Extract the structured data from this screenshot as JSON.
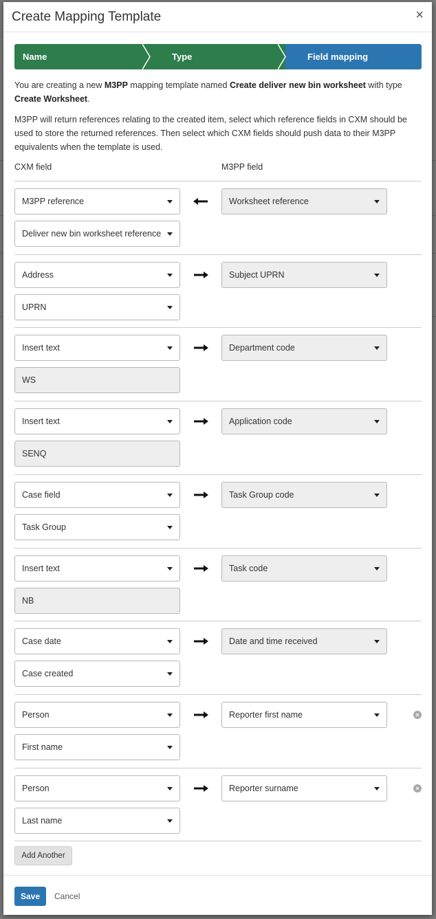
{
  "modal": {
    "title": "Create Mapping Template",
    "close_label": "×"
  },
  "wizard": {
    "steps": [
      {
        "label": "Name",
        "state": "done"
      },
      {
        "label": "Type",
        "state": "done"
      },
      {
        "label": "Field mapping",
        "state": "active"
      }
    ],
    "colors": {
      "done": "#2e7d4c",
      "active": "#2b76b1"
    }
  },
  "intro": {
    "p1_a": "You are creating a new ",
    "p1_system": "M3PP",
    "p1_b": " mapping template named ",
    "p1_name": "Create deliver new bin worksheet",
    "p1_c": " with type ",
    "p1_type": "Create Worksheet",
    "p1_d": ".",
    "p2": "M3PP will return references relating to the created item, select which reference fields in CXM should be used to store the returned references. Then select which CXM fields should push data to their M3PP equivalents when the template is used."
  },
  "columns": {
    "cxm": "CXM field",
    "m3pp": "M3PP field"
  },
  "mappings": [
    {
      "cxm_source": "M3PP reference",
      "cxm_detail": "Deliver new bin worksheet reference",
      "detail_type": "select",
      "direction": "left",
      "m3pp_field": "Worksheet reference",
      "m3pp_locked": true,
      "removable": false
    },
    {
      "cxm_source": "Address",
      "cxm_detail": "UPRN",
      "detail_type": "select",
      "direction": "right",
      "m3pp_field": "Subject UPRN",
      "m3pp_locked": true,
      "removable": false
    },
    {
      "cxm_source": "Insert text",
      "cxm_detail": "WS",
      "detail_type": "text",
      "direction": "right",
      "m3pp_field": "Department code",
      "m3pp_locked": true,
      "removable": false
    },
    {
      "cxm_source": "Insert text",
      "cxm_detail": "SENQ",
      "detail_type": "text",
      "direction": "right",
      "m3pp_field": "Application code",
      "m3pp_locked": true,
      "removable": false
    },
    {
      "cxm_source": "Case field",
      "cxm_detail": "Task Group",
      "detail_type": "select",
      "direction": "right",
      "m3pp_field": "Task Group code",
      "m3pp_locked": true,
      "removable": false
    },
    {
      "cxm_source": "Insert text",
      "cxm_detail": "NB",
      "detail_type": "text",
      "direction": "right",
      "m3pp_field": "Task code",
      "m3pp_locked": true,
      "removable": false
    },
    {
      "cxm_source": "Case date",
      "cxm_detail": "Case created",
      "detail_type": "select",
      "direction": "right",
      "m3pp_field": "Date and time received",
      "m3pp_locked": true,
      "removable": false
    },
    {
      "cxm_source": "Person",
      "cxm_detail": "First name",
      "detail_type": "select",
      "direction": "right",
      "m3pp_field": "Reporter first name",
      "m3pp_locked": false,
      "removable": true
    },
    {
      "cxm_source": "Person",
      "cxm_detail": "Last name",
      "detail_type": "select",
      "direction": "right",
      "m3pp_field": "Reporter surname",
      "m3pp_locked": false,
      "removable": true
    }
  ],
  "actions": {
    "add_another": "Add Another",
    "save": "Save",
    "cancel": "Cancel"
  }
}
